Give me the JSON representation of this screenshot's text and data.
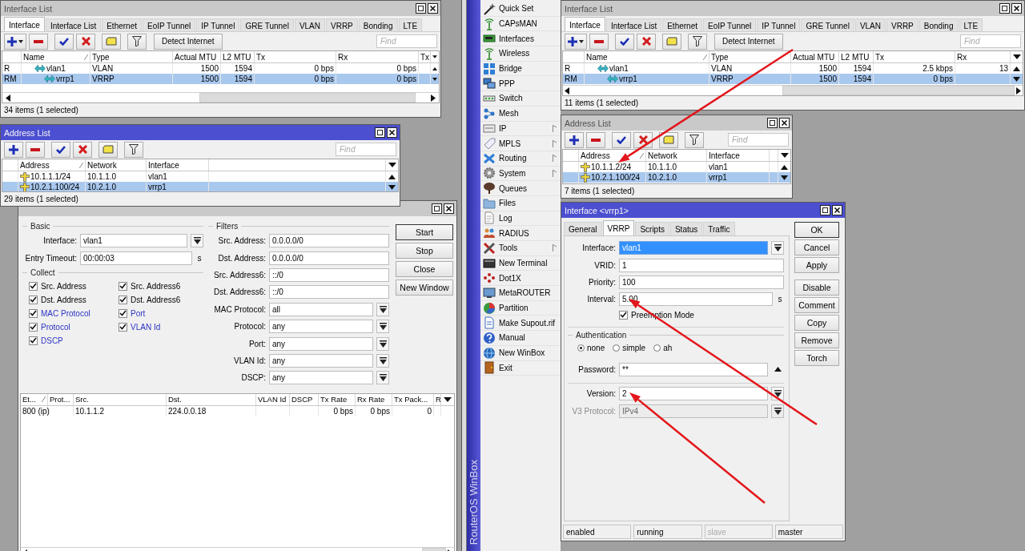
{
  "interface_list_left": {
    "title": "Interface List",
    "active": false,
    "tabs": [
      {
        "label": "Interface",
        "selected": true
      },
      {
        "label": "Interface List",
        "selected": false
      },
      {
        "label": "Ethernet",
        "selected": false
      },
      {
        "label": "EoIP Tunnel",
        "selected": false
      },
      {
        "label": "IP Tunnel",
        "selected": false
      },
      {
        "label": "GRE Tunnel",
        "selected": false
      },
      {
        "label": "VLAN",
        "selected": false
      },
      {
        "label": "VRRP",
        "selected": false
      },
      {
        "label": "Bonding",
        "selected": false
      },
      {
        "label": "LTE",
        "selected": false
      }
    ],
    "detect_button": "Detect Internet",
    "find_placeholder": "Find",
    "columns": [
      "Name",
      "Type",
      "Actual MTU",
      "L2 MTU",
      "Tx",
      "Rx",
      "Tx"
    ],
    "rows": [
      {
        "flags": "R",
        "name": "vlan1",
        "type": "VLAN",
        "actual_mtu": "1500",
        "l2_mtu": "1594",
        "tx": "0 bps",
        "rx": "0 bps",
        "selected": false,
        "children": [
          {
            "flags": "RM",
            "name": "vrrp1",
            "type": "VRRP",
            "actual_mtu": "1500",
            "l2_mtu": "1594",
            "tx": "0 bps",
            "rx": "0 bps",
            "selected": true
          }
        ]
      }
    ],
    "status": "34 items (1 selected)"
  },
  "address_list_left": {
    "title": "Address List",
    "active": true,
    "find_placeholder": "Find",
    "columns": [
      "Address",
      "Network",
      "Interface"
    ],
    "rows": [
      {
        "address": "10.1.1.1/24",
        "network": "10.1.1.0",
        "interface": "vlan1",
        "selected": false
      },
      {
        "address": "10.2.1.100/24",
        "network": "10.2.1.0",
        "interface": "vrrp1",
        "selected": true
      }
    ],
    "status": "29 items (1 selected)"
  },
  "torch": {
    "active": false,
    "basic_label": "Basic",
    "basic_fields": [
      {
        "label": "Interface:",
        "value": "vlan1",
        "kind": "dropdown"
      },
      {
        "label": "Entry Timeout:",
        "value": "00:00:03",
        "kind": "text",
        "unit": "s"
      }
    ],
    "collect_label": "Collect",
    "collect": [
      {
        "label": "Src. Address",
        "checked": true,
        "emphasized": false
      },
      {
        "label": "Src. Address6",
        "checked": true,
        "emphasized": false
      },
      {
        "label": "Dst. Address",
        "checked": true,
        "emphasized": false
      },
      {
        "label": "Dst. Address6",
        "checked": true,
        "emphasized": false
      },
      {
        "label": "MAC Protocol",
        "checked": true,
        "emphasized": true
      },
      {
        "label": "Port",
        "checked": true,
        "emphasized": true
      },
      {
        "label": "Protocol",
        "checked": true,
        "emphasized": true
      },
      {
        "label": "VLAN Id",
        "checked": true,
        "emphasized": true
      },
      {
        "label": "DSCP",
        "checked": true,
        "emphasized": true
      }
    ],
    "filters_label": "Filters",
    "filters": [
      {
        "label": "Src. Address:",
        "value": "0.0.0.0/0",
        "kind": "text"
      },
      {
        "label": "Dst. Address:",
        "value": "0.0.0.0/0",
        "kind": "text"
      },
      {
        "label": "Src. Address6:",
        "value": "::/0",
        "kind": "text"
      },
      {
        "label": "Dst. Address6:",
        "value": "::/0",
        "kind": "text"
      },
      {
        "label": "MAC Protocol:",
        "value": "all",
        "kind": "dropdown"
      },
      {
        "label": "Protocol:",
        "value": "any",
        "kind": "dropdown"
      },
      {
        "label": "Port:",
        "value": "any",
        "kind": "dropdown"
      },
      {
        "label": "VLAN Id:",
        "value": "any",
        "kind": "dropdown"
      },
      {
        "label": "DSCP:",
        "value": "any",
        "kind": "dropdown"
      }
    ],
    "buttons": [
      {
        "label": "Start",
        "default": true
      },
      {
        "label": "Stop",
        "default": false
      },
      {
        "label": "Close",
        "default": false
      },
      {
        "label": "New Window",
        "default": false
      }
    ],
    "columns": [
      "Et...",
      "Prot...",
      "Src.",
      "Dst.",
      "VLAN Id",
      "DSCP",
      "Tx Rate",
      "Rx Rate",
      "Tx Pack...",
      "R"
    ],
    "rows": [
      {
        "eth_type": "800 (ip)",
        "src": "10.1.1.2",
        "dst": "224.0.0.18",
        "tx_rate": "0 bps",
        "rx_rate": "0 bps",
        "tx_packets": "0"
      }
    ]
  },
  "sidebar": {
    "title": "RouterOS WinBox",
    "items": [
      {
        "label": "Quick Set",
        "submenu": false
      },
      {
        "label": "CAPsMAN",
        "submenu": false
      },
      {
        "label": "Interfaces",
        "submenu": false
      },
      {
        "label": "Wireless",
        "submenu": false
      },
      {
        "label": "Bridge",
        "submenu": false
      },
      {
        "label": "PPP",
        "submenu": false
      },
      {
        "label": "Switch",
        "submenu": false
      },
      {
        "label": "Mesh",
        "submenu": false
      },
      {
        "label": "IP",
        "submenu": true
      },
      {
        "label": "MPLS",
        "submenu": true
      },
      {
        "label": "Routing",
        "submenu": true
      },
      {
        "label": "System",
        "submenu": true
      },
      {
        "label": "Queues",
        "submenu": false
      },
      {
        "label": "Files",
        "submenu": false
      },
      {
        "label": "Log",
        "submenu": false
      },
      {
        "label": "RADIUS",
        "submenu": false
      },
      {
        "label": "Tools",
        "submenu": true
      },
      {
        "label": "New Terminal",
        "submenu": false
      },
      {
        "label": "Dot1X",
        "submenu": false
      },
      {
        "label": "MetaROUTER",
        "submenu": false
      },
      {
        "label": "Partition",
        "submenu": false
      },
      {
        "label": "Make Supout.rif",
        "submenu": false
      },
      {
        "label": "Manual",
        "submenu": false
      },
      {
        "label": "New WinBox",
        "submenu": false
      },
      {
        "label": "Exit",
        "submenu": false
      }
    ]
  },
  "interface_list_right": {
    "title": "Interface List",
    "active": false,
    "tabs": [
      {
        "label": "Interface",
        "selected": true
      },
      {
        "label": "Interface List",
        "selected": false
      },
      {
        "label": "Ethernet",
        "selected": false
      },
      {
        "label": "EoIP Tunnel",
        "selected": false
      },
      {
        "label": "IP Tunnel",
        "selected": false
      },
      {
        "label": "GRE Tunnel",
        "selected": false
      },
      {
        "label": "VLAN",
        "selected": false
      },
      {
        "label": "VRRP",
        "selected": false
      },
      {
        "label": "Bonding",
        "selected": false
      },
      {
        "label": "LTE",
        "selected": false
      }
    ],
    "detect_button": "Detect Internet",
    "find_placeholder": "Find",
    "columns": [
      "Name",
      "Type",
      "Actual MTU",
      "L2 MTU",
      "Tx",
      "Rx"
    ],
    "rows": [
      {
        "flags": "R",
        "name": "vlan1",
        "type": "VLAN",
        "actual_mtu": "1500",
        "l2_mtu": "1594",
        "tx": "2.5 kbps",
        "rx": "13",
        "selected": false,
        "children": [
          {
            "flags": "RM",
            "name": "vrrp1",
            "type": "VRRP",
            "actual_mtu": "1500",
            "l2_mtu": "1594",
            "tx": "0 bps",
            "selected": true
          }
        ]
      }
    ],
    "status": "11 items (1 selected)"
  },
  "address_list_right": {
    "title": "Address List",
    "active": false,
    "find_placeholder": "Find",
    "columns": [
      "Address",
      "Network",
      "Interface"
    ],
    "rows": [
      {
        "address": "10.1.1.2/24",
        "network": "10.1.1.0",
        "interface": "vlan1",
        "selected": false
      },
      {
        "address": "10.2.1.100/24",
        "network": "10.2.1.0",
        "interface": "vrrp1",
        "selected": true
      }
    ],
    "status": "7 items (1 selected)"
  },
  "vrrp_window": {
    "title": "Interface <vrrp1>",
    "active": true,
    "tabs": [
      {
        "label": "General",
        "selected": false
      },
      {
        "label": "VRRP",
        "selected": true
      },
      {
        "label": "Scripts",
        "selected": false
      },
      {
        "label": "Status",
        "selected": false
      },
      {
        "label": "Traffic",
        "selected": false
      }
    ],
    "fields": [
      {
        "label": "Interface:",
        "value": "vlan1",
        "kind": "dropdown",
        "highlighted": true
      },
      {
        "label": "VRID:",
        "value": "1",
        "kind": "text",
        "highlighted": false
      },
      {
        "label": "Priority:",
        "value": "100",
        "kind": "text",
        "highlighted": false
      },
      {
        "label": "Interval:",
        "value": "5.00",
        "kind": "text",
        "unit": "s",
        "highlighted": false
      }
    ],
    "preemption": {
      "label": "Preemption Mode",
      "checked": true
    },
    "auth_label": "Authentication",
    "auth_options": [
      {
        "label": "none",
        "selected": true
      },
      {
        "label": "simple",
        "selected": false
      },
      {
        "label": "ah",
        "selected": false
      }
    ],
    "password": {
      "label": "Password:",
      "value": "**",
      "kind": "secret"
    },
    "version_fields": [
      {
        "label": "Version:",
        "value": "2",
        "kind": "dropdown",
        "disabled": false
      },
      {
        "label": "V3 Protocol:",
        "value": "IPv4",
        "kind": "dropdown",
        "disabled": true
      }
    ],
    "buttons": [
      {
        "label": "OK",
        "default": true
      },
      {
        "label": "Cancel",
        "default": false
      },
      {
        "label": "Apply",
        "default": false
      },
      {
        "label": "Disable",
        "default": false
      },
      {
        "label": "Comment",
        "default": false
      },
      {
        "label": "Copy",
        "default": false
      },
      {
        "label": "Remove",
        "default": false
      },
      {
        "label": "Torch",
        "default": false
      }
    ],
    "status": [
      {
        "text": "enabled",
        "disabled": false
      },
      {
        "text": "running",
        "disabled": false
      },
      {
        "text": "slave",
        "disabled": true
      },
      {
        "text": "master",
        "disabled": false
      }
    ]
  }
}
